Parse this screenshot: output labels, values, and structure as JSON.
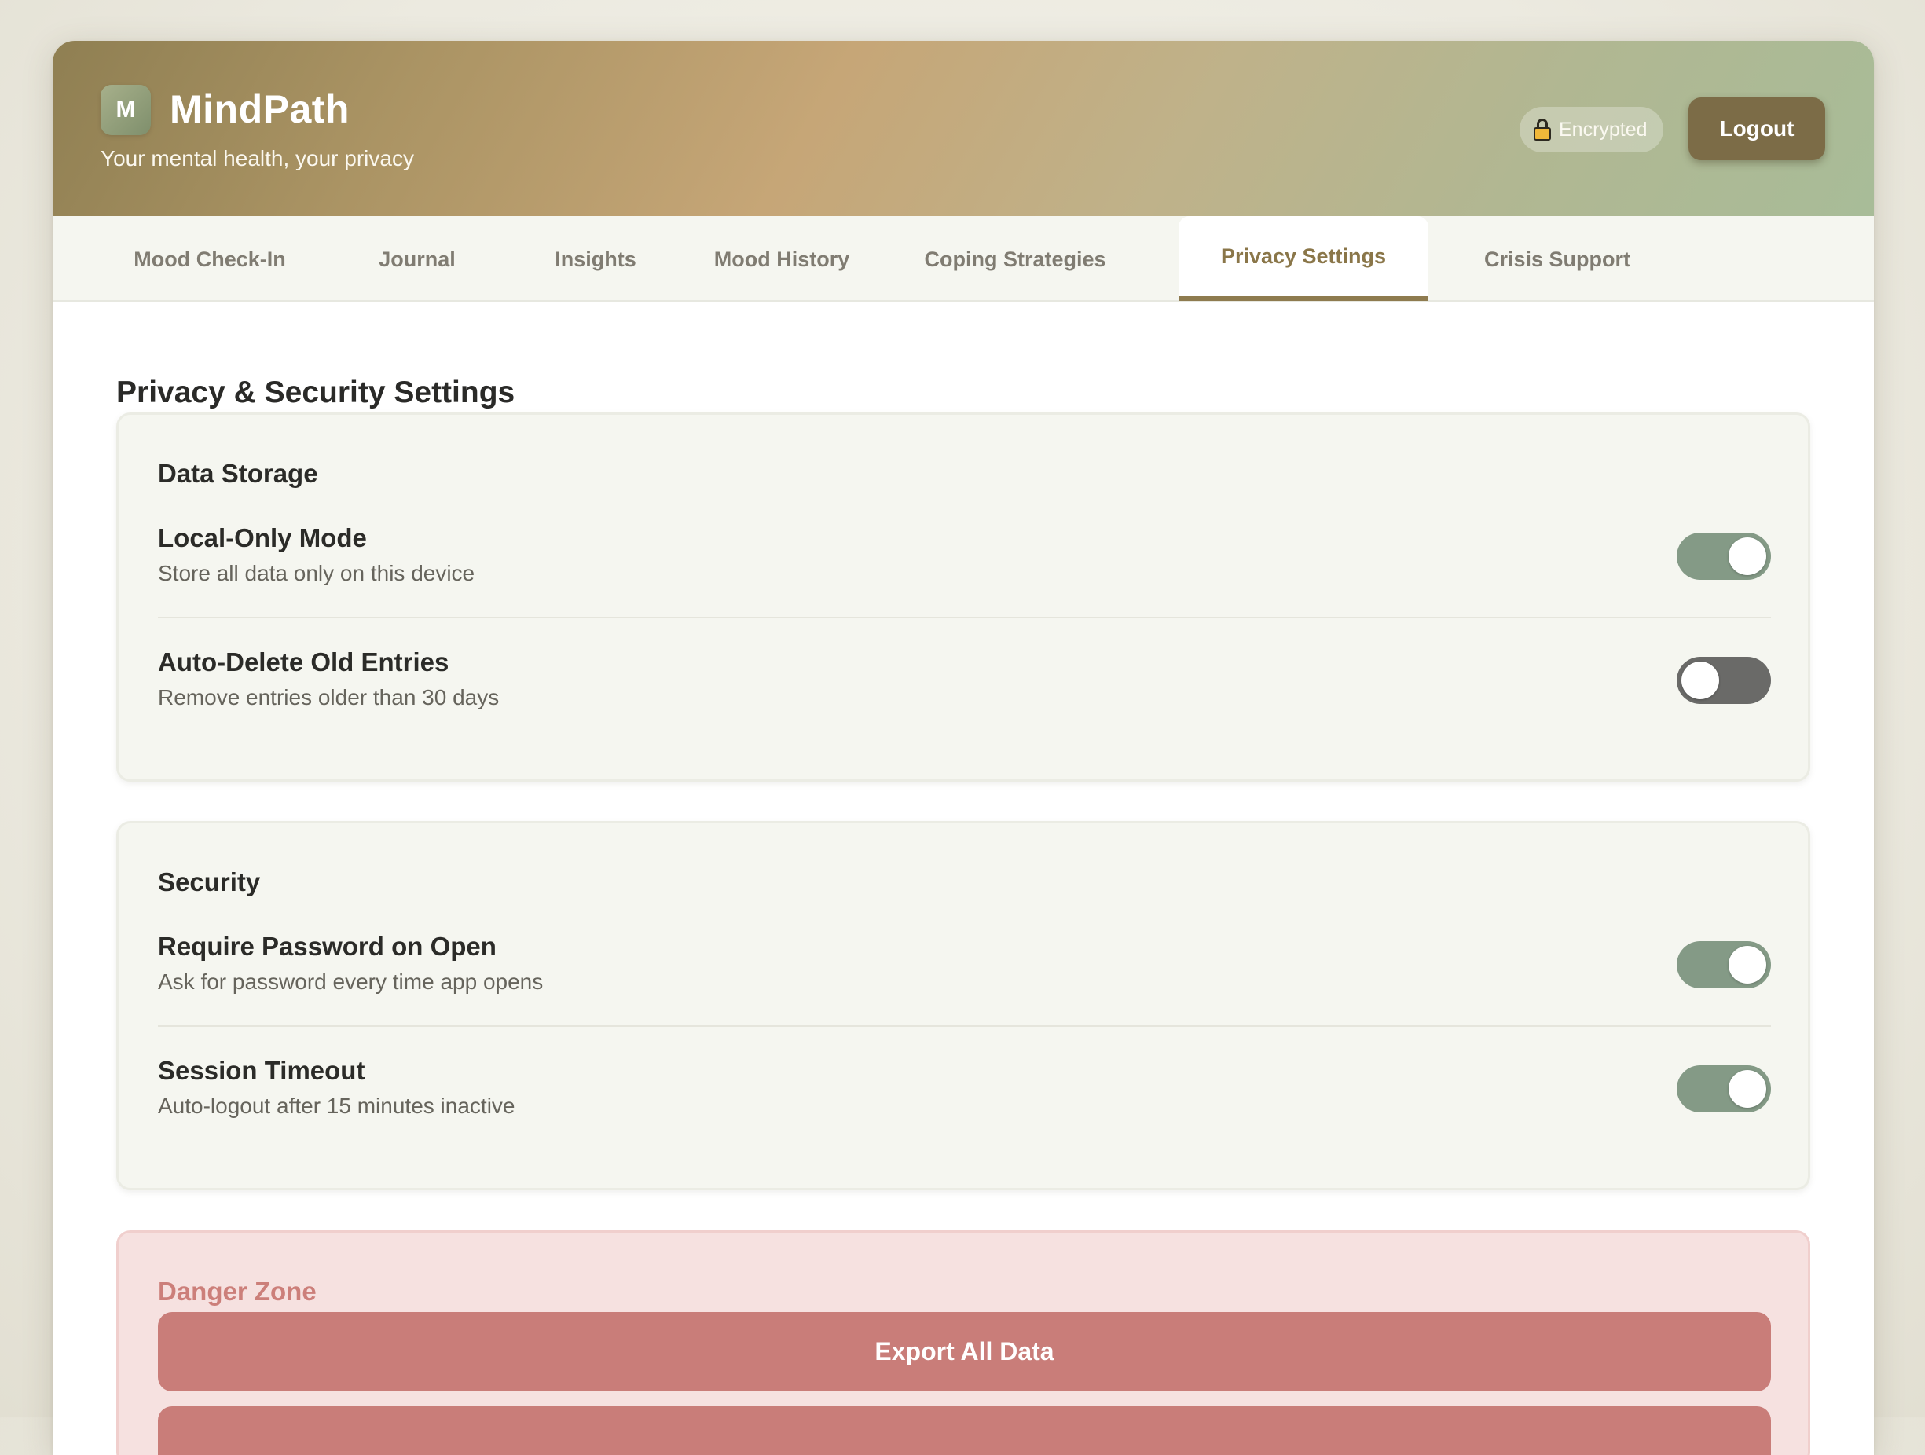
{
  "app": {
    "logo_letter": "M",
    "title": "MindPath",
    "subtitle": "Your mental health, your privacy",
    "encrypted_label": "Encrypted",
    "logout_label": "Logout"
  },
  "tabs": [
    {
      "label": "Mood Check-In",
      "active": false
    },
    {
      "label": "Journal",
      "active": false
    },
    {
      "label": "Insights",
      "active": false
    },
    {
      "label": "Mood History",
      "active": false
    },
    {
      "label": "Coping Strategies",
      "active": false
    },
    {
      "label": "Privacy Settings",
      "active": true
    },
    {
      "label": "Crisis Support",
      "active": false
    }
  ],
  "page": {
    "title": "Privacy & Security Settings"
  },
  "data_storage": {
    "heading": "Data Storage",
    "settings": [
      {
        "label": "Local-Only Mode",
        "description": "Store all data only on this device",
        "enabled": true
      },
      {
        "label": "Auto-Delete Old Entries",
        "description": "Remove entries older than 30 days",
        "enabled": false
      }
    ]
  },
  "security": {
    "heading": "Security",
    "settings": [
      {
        "label": "Require Password on Open",
        "description": "Ask for password every time app opens",
        "enabled": true
      },
      {
        "label": "Session Timeout",
        "description": "Auto-logout after 15 minutes inactive",
        "enabled": true
      }
    ]
  },
  "danger_zone": {
    "heading": "Danger Zone",
    "export_label": "Export All Data"
  },
  "colors": {
    "accent": "#8e7b4f",
    "toggle_on": "#849a86",
    "toggle_off": "#6a6a68",
    "danger_button": "#c97d79",
    "danger_background": "#f6e1e0"
  }
}
